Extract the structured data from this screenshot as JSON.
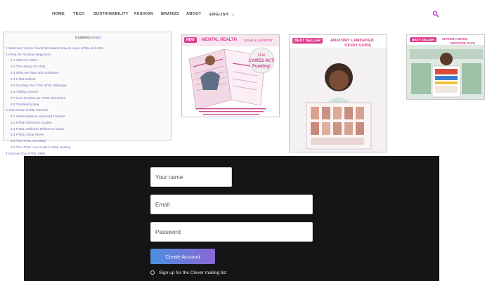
{
  "nav": {
    "items": [
      "HOME",
      "TECH",
      "SUSTAINABILITY",
      "FASHION",
      "BRANDS",
      "ABOUT"
    ],
    "language": "ENGLISH",
    "language_chevron_icon": "chevron-down-icon",
    "search_icon": "search-icon",
    "accent_color": "#c636c6"
  },
  "toc": {
    "title": "Contents",
    "toggle": "[hide]",
    "items": [
      "1 Welcome! You've Found the Easiest Way to Learn HTML and CSS.",
      "2 HTML for Absolute Beginners",
      "2.1 What is HTML?",
      "2.2 The History of HTML",
      "2.3 What are Tags and Attributes?",
      "2.4 HTML Editors",
      "2.5 Creating Your First HTML Webpage",
      "2.6 Adding Content",
      "2.7 How To Close an HTML Document",
      "2.8 Troubleshooting",
      "3 Your Orown HTML Tutorials",
      "3.1 Intermediate & Advanced Tutorials",
      "3.2 HTML Reference Guides",
      "3.3 HTML Attributes Reference Guide",
      "3.4 HTML Cheat Sheet",
      "3.5 The HTML.com Blog",
      "3.6 The HTML.com Guide to Web Hosting",
      "4 Improve Your HTML Skills"
    ]
  },
  "products": [
    {
      "badge": "NEW",
      "headline": "MENTAL HEALTH",
      "sub": "SIGNS & SUPPORT",
      "promo_line1": "Use",
      "promo_line2": "CARES ACT",
      "promo_line3": "Funding!",
      "badge_color": "#e03a8c"
    },
    {
      "badge": "BEST SELLER",
      "headline_line1": "ANATOMY LAMINATED",
      "headline_line2": "STUDY GUIDE",
      "badge_color": "#e03a8c"
    },
    {
      "badge": "BEST SELLER",
      "headline_line1": "SPANISH GRADE",
      "headline_line2": "BOOSTER PACK",
      "badge_color": "#e03a8c"
    }
  ],
  "form": {
    "name_placeholder": "Your name",
    "email_placeholder": "Email",
    "password_placeholder": "Password",
    "submit_label": "Create Account",
    "mailing_label": "Sign up for the Clever mailing list"
  }
}
